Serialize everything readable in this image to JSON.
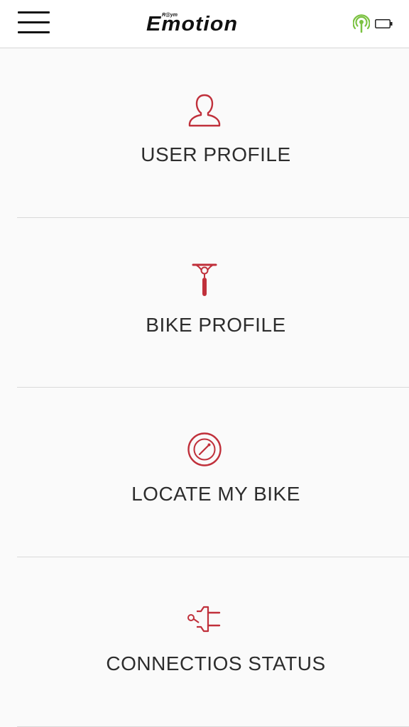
{
  "header": {
    "logo_small": "R@ym",
    "logo_text": "Emotion",
    "icons": {
      "menu": "hamburger-menu-icon",
      "signal": "signal-broadcast-icon",
      "battery": "battery-icon"
    },
    "colors": {
      "signal": "#7cc242",
      "text": "#111111"
    }
  },
  "menu": {
    "accent_color": "#c0303b",
    "items": [
      {
        "label": "USER PROFILE",
        "icon": "user-icon"
      },
      {
        "label": "BIKE PROFILE",
        "icon": "bike-icon"
      },
      {
        "label": "LOCATE MY BIKE",
        "icon": "compass-icon"
      },
      {
        "label": "CONNECTIOS STATUS",
        "icon": "plug-icon"
      }
    ]
  }
}
